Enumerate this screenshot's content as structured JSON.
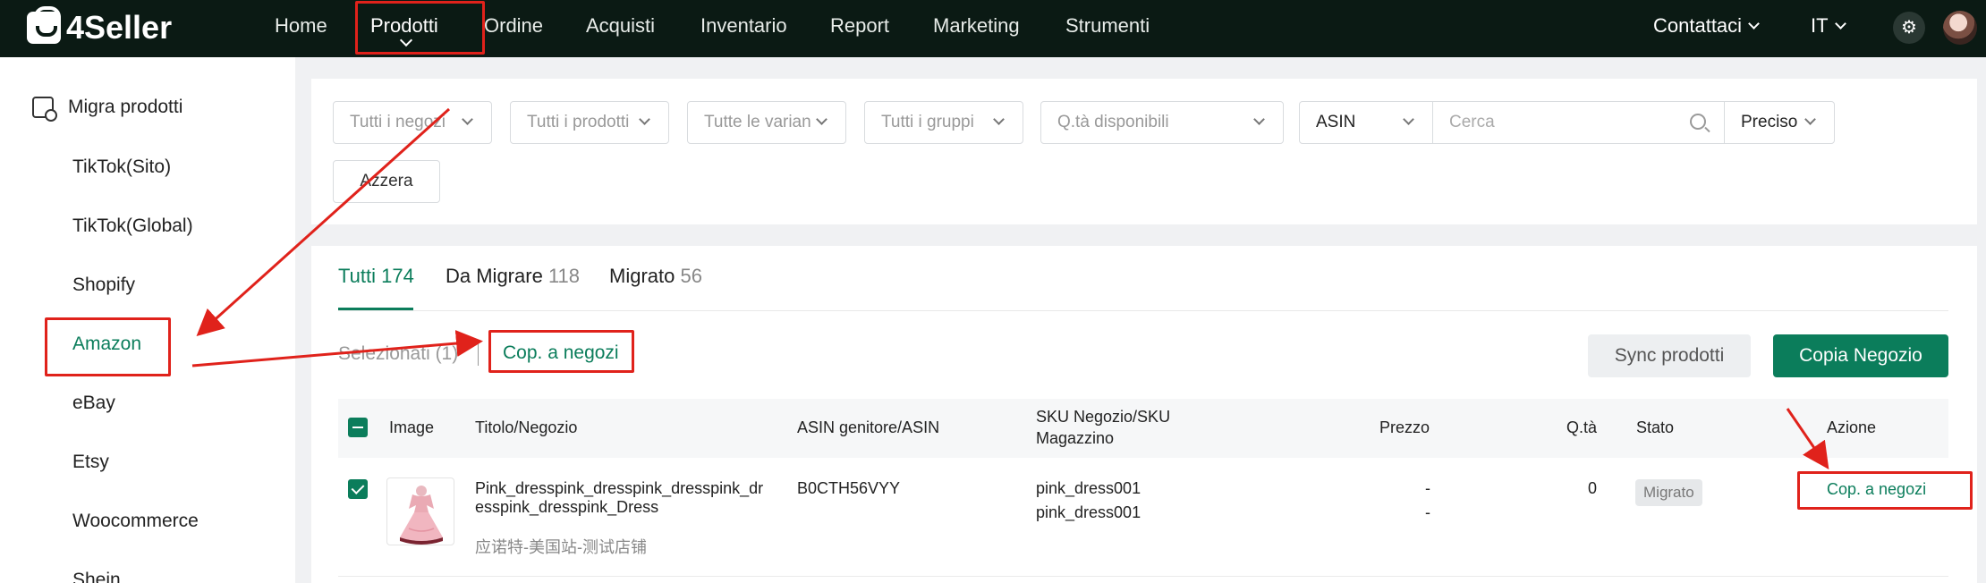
{
  "brand": {
    "name": "4Seller"
  },
  "nav": {
    "items": [
      "Home",
      "Prodotti",
      "Ordine",
      "Acquisti",
      "Inventario",
      "Report",
      "Marketing",
      "Strumenti"
    ],
    "contact": "Contattaci",
    "language": "IT"
  },
  "sidebar": {
    "header": "Migra prodotti",
    "items": [
      "TikTok(Sito)",
      "TikTok(Global)",
      "Shopify",
      "Amazon",
      "eBay",
      "Etsy",
      "Woocommerce",
      "Shein"
    ],
    "active": "Amazon"
  },
  "filters": {
    "shops": "Tutti i negozi",
    "products": "Tutti i prodotti",
    "variants": "Tutte le varian",
    "groups": "Tutti i gruppi",
    "qty": "Q.tà disponibili",
    "search_field": "ASIN",
    "search_placeholder": "Cerca",
    "match": "Preciso",
    "reset": "Azzera"
  },
  "tabs": [
    {
      "label": "Tutti",
      "count": "174"
    },
    {
      "label": "Da Migrare",
      "count": "118"
    },
    {
      "label": "Migrato",
      "count": "56"
    }
  ],
  "toolbar": {
    "selected": "Selezionati (1)",
    "copy_to_shops": "Cop. a negozi",
    "sync": "Sync prodotti",
    "copy_shop": "Copia Negozio"
  },
  "table": {
    "columns": [
      "Image",
      "Titolo/Negozio",
      "ASIN genitore/ASIN",
      "SKU Negozio/SKU",
      "Magazzino",
      "Prezzo",
      "Q.tà",
      "Stato",
      "Azione"
    ],
    "rows": [
      {
        "title_line1": "Pink_dresspink_dresspink_dresspink_dr",
        "title_line2": "esspink_dresspink_Dress",
        "shop": "应诺特-美国站-测试店铺",
        "asin": "B0CTH56VYY",
        "sku_shop": "pink_dress001",
        "sku_warehouse": "pink_dress001",
        "price_1": "-",
        "price_2": "-",
        "qty": "0",
        "status": "Migrato",
        "action": "Cop. a negozi"
      }
    ]
  },
  "colors": {
    "accent": "#0b7d5b",
    "topbar": "#0b1a14",
    "annotation": "#e0221b"
  }
}
